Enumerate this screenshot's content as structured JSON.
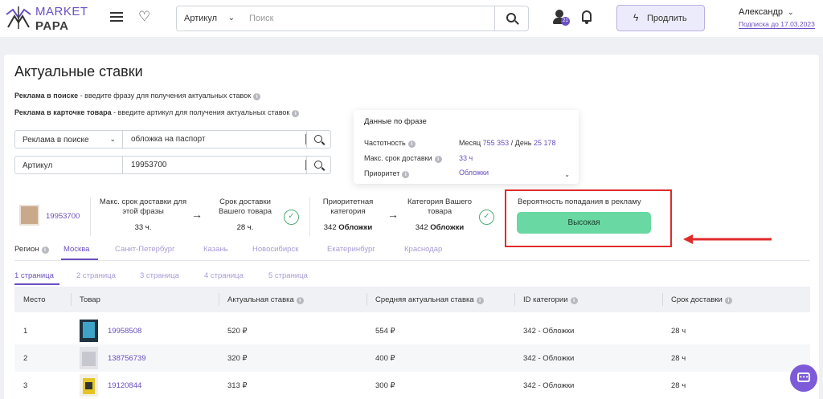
{
  "header": {
    "logo_line1": "MARKET",
    "logo_line2": "PAPA",
    "search_type": "Артикул",
    "search_placeholder": "Поиск",
    "notification_count": "21",
    "promote_label": "Продлить",
    "user_name": "Александр",
    "subscription": "Подписка до 17.03.2023"
  },
  "page": {
    "title": "Актуальные ставки",
    "desc1_bold": "Реклама в поиске",
    "desc1_text": " - введите фразу для получения актуальных ставок",
    "desc2_bold": "Реклама в карточке товара",
    "desc2_text": " - введите артикул для получения актуальных ставок"
  },
  "filters": {
    "ad_type": "Реклама в поиске",
    "phrase": "обложка на паспорт",
    "article_label": "Артикул",
    "article": "19953700"
  },
  "phrase_data": {
    "title": "Данные по фразе",
    "frequency_label": "Частотность",
    "month_label": "Месяц",
    "month_value": "755 353",
    "day_label": "День",
    "day_value": "25 178",
    "max_delivery_label": "Макс. срок доставки",
    "max_delivery_value": "33 ч",
    "priority_label": "Приоритет",
    "priority_value": "Обложки"
  },
  "stats": {
    "product_id": "19953700",
    "max_delivery_title": "Макс. срок доставки для этой фразы",
    "max_delivery_value": "33 ч.",
    "your_delivery_title": "Срок доставки Вашего товара",
    "your_delivery_value": "28 ч.",
    "priority_cat_title": "Приоритетная категория",
    "priority_cat_id": "342",
    "priority_cat_name": "Обложки",
    "your_cat_title": "Категория Вашего товара",
    "your_cat_id": "342",
    "your_cat_name": "Обложки",
    "probability_title": "Вероятность попадания в рекламу",
    "probability_value": "Высокая"
  },
  "regions": {
    "label": "Регион",
    "items": [
      "Москва",
      "Санкт-Петербург",
      "Казань",
      "Новосибирск",
      "Екатеринбург",
      "Краснодар"
    ],
    "active": "Москва"
  },
  "pages": [
    "1 страница",
    "2 страница",
    "3 страница",
    "4 страница",
    "5 страница"
  ],
  "table": {
    "columns": [
      "Место",
      "Товар",
      "Актуальная ставка",
      "Средняя актуальная ставка",
      "ID категории",
      "Срок доставки"
    ],
    "rows": [
      {
        "place": "1",
        "product": "19958508",
        "bid": "520 ₽",
        "avg_bid": "554 ₽",
        "category": "342 - Обложки",
        "delivery": "28 ч"
      },
      {
        "place": "2",
        "product": "138756739",
        "bid": "320 ₽",
        "avg_bid": "400 ₽",
        "category": "342 - Обложки",
        "delivery": "28 ч"
      },
      {
        "place": "3",
        "product": "19120844",
        "bid": "313 ₽",
        "avg_bid": "300 ₽",
        "category": "342 - Обложки",
        "delivery": "28 ч"
      }
    ]
  },
  "icons": {
    "menu": "menu-icon",
    "favorites": "heart-icon",
    "search": "search-icon",
    "user": "user-icon",
    "notifications": "bell-icon",
    "promote": "bolt-icon",
    "info": "info-icon",
    "check": "check-circle-icon",
    "arrow": "arrow-right-icon",
    "chat": "chat-icon"
  },
  "colors": {
    "accent": "#6a4fc2",
    "success": "#69d8a2",
    "highlight": "#e02b2b"
  }
}
